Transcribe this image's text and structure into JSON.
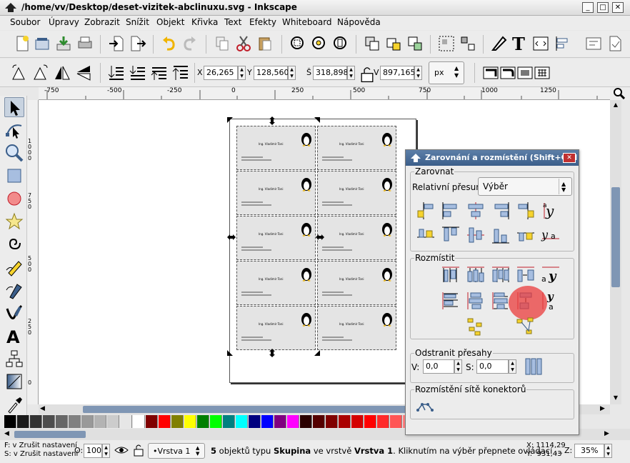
{
  "window": {
    "title": "/home/vv/Desktop/deset-vizitek-abclinuxu.svg - Inkscape",
    "min_label": "_",
    "max_label": "□",
    "close_label": "✕"
  },
  "menu": [
    "Soubor",
    "Úpravy",
    "Zobrazit",
    "Snížit",
    "Objekt",
    "Křivka",
    "Text",
    "Efekty",
    "Whiteboard",
    "Nápověda"
  ],
  "toolbar2": {
    "x_label": "X",
    "x_value": "26,265",
    "y_label": "Y",
    "y_value": "128,560",
    "w_label": "Š",
    "w_value": "318,898",
    "h_label": "V",
    "h_value": "897,165",
    "unit": "px"
  },
  "ruler": {
    "h_ticks": [
      "-750",
      "-500",
      "-250",
      "0",
      "250",
      "500",
      "750",
      "1000",
      "1250"
    ],
    "v_ticks": [
      "1000",
      "750",
      "500",
      "250",
      "0"
    ]
  },
  "card": {
    "name": "Ing. Vladimír Toni"
  },
  "dialog": {
    "title": "Zarovnání a rozmístění (Shift+Ctrl",
    "close_label": "✕",
    "align_title": "Zarovnat",
    "relative_label": "Relativní přesun",
    "relative_value": "Výběr",
    "distribute_title": "Rozmístit",
    "overlap_title": "Odstranit přesahy",
    "h_label": "V:",
    "h_value": "0,0",
    "v_label": "S:",
    "v_value": "0,0",
    "network_title": "Rozmístění sítě konektorů"
  },
  "status": {
    "fill_label": "F:",
    "fill_value": "v Zrušit nastavení",
    "stroke_label": "S:",
    "stroke_value": "v Zrušit nastavení",
    "opacity_label": "O:",
    "opacity_value": "100",
    "layer": "•Vrstva 1",
    "msg_count": "5",
    "msg_text": " objektů typu ",
    "msg_group": "Skupina",
    "msg_text2": " ve vrstvě ",
    "msg_layer": "Vrstva 1",
    "msg_tail": ". Kliknutím na výběr přepnete ovládací ...",
    "x_coord": "X: 1114,29",
    "y_coord": "Y:  931,43",
    "zoom_label": "Z:",
    "zoom_value": "35%"
  },
  "palette": [
    "#000000",
    "#1a1a1a",
    "#333333",
    "#4d4d4d",
    "#666666",
    "#808080",
    "#999999",
    "#b3b3b3",
    "#cccccc",
    "#e6e6e6",
    "#ffffff",
    "#800000",
    "#ff0000",
    "#808000",
    "#ffff00",
    "#008000",
    "#00ff00",
    "#008080",
    "#00ffff",
    "#000080",
    "#0000ff",
    "#800080",
    "#ff00ff",
    "#2b0000",
    "#550000",
    "#800000",
    "#aa0000",
    "#d40000",
    "#ff0000",
    "#ff2a2a",
    "#ff5555",
    "#ff8080",
    "#ffaaaa",
    "#ffd5d5"
  ]
}
